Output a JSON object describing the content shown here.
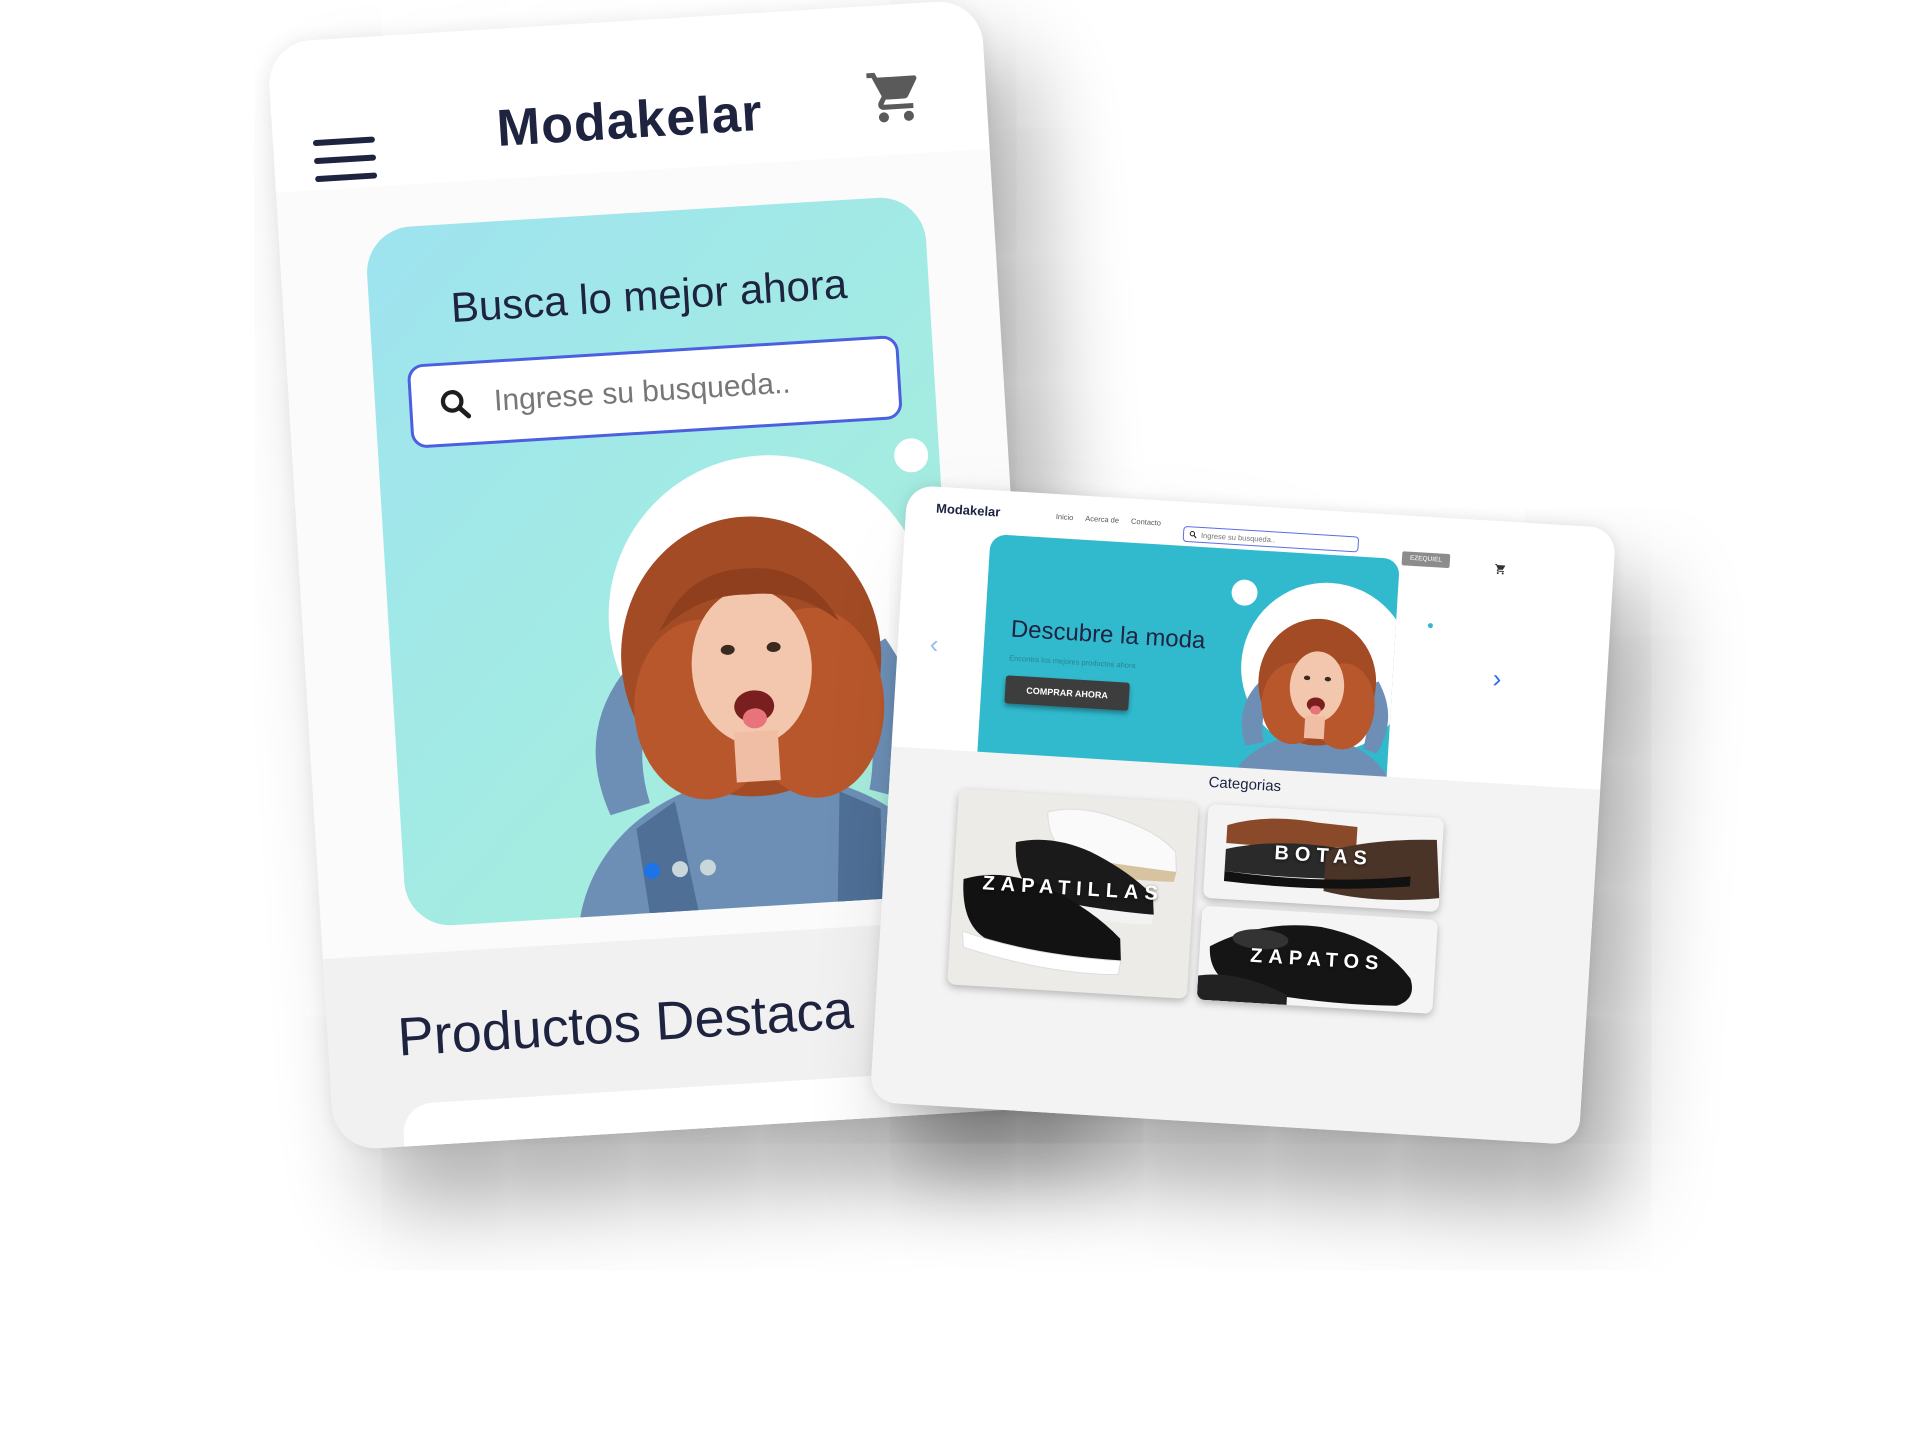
{
  "mobile": {
    "brand": "Modakelar",
    "hero_title": "Busca lo mejor ahora",
    "search_placeholder": "Ingrese su busqueda..",
    "featured_title": "Productos Destaca"
  },
  "desktop": {
    "brand": "Modakelar",
    "nav": [
      "Inicio",
      "Acerca de",
      "Contacto"
    ],
    "search_placeholder": "Ingrese su busqueda..",
    "user_label": "EZEQUIEL",
    "hero_title": "Descubre la moda",
    "hero_subtitle": "Encontra los mejores productos ahora",
    "cta_label": "COMPRAR AHORA",
    "categories_title": "Categorias",
    "categories": [
      "ZAPATILLAS",
      "BOTAS",
      "ZAPATOS"
    ]
  },
  "colors": {
    "brand_text": "#1e2340",
    "mobile_hero_gradient_start": "#9ee3ef",
    "mobile_hero_gradient_end": "#a8ecd8",
    "desktop_hero": "#31b9cd",
    "search_border": "#4b5fe0",
    "carousel_dot_active": "#1d74e8",
    "cta_button": "#3d3d3d"
  },
  "icons": {
    "menu": "hamburger-icon",
    "cart": "cart-icon",
    "search": "search-icon",
    "prev": "chevron-left-icon",
    "next": "chevron-right-icon"
  }
}
